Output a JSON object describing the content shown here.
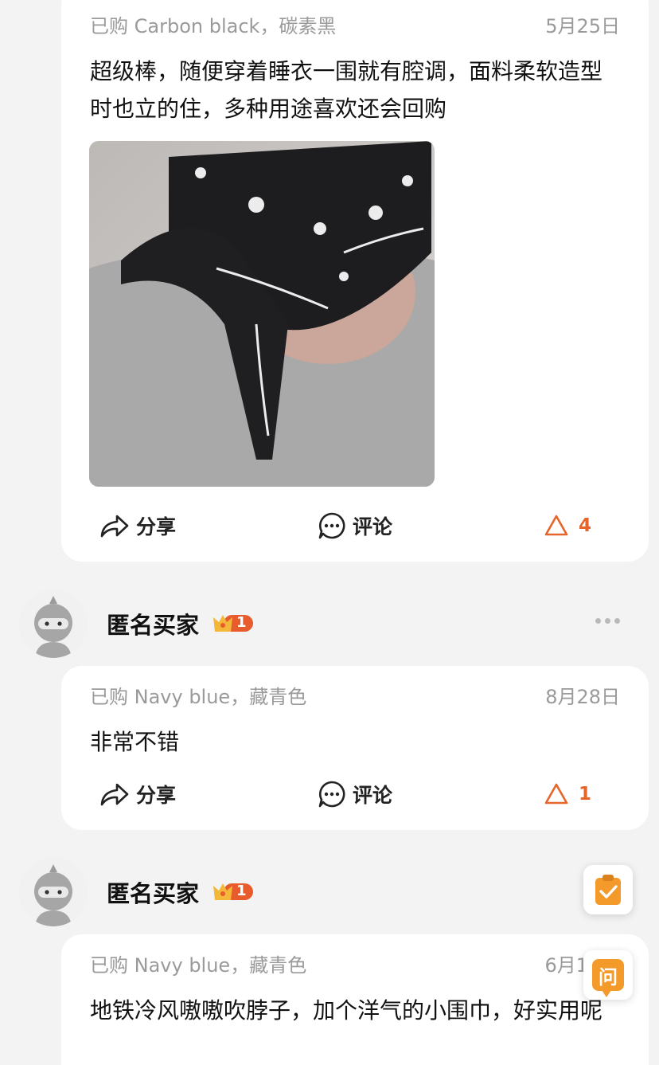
{
  "reviews": [
    {
      "purchased_variant": "已购 Carbon black，碳素黑",
      "date": "5月25日",
      "text": "超级棒，随便穿着睡衣一围就有腔调，面料柔软造型时也立的住，多种用途喜欢还会回购",
      "share_label": "分享",
      "comment_label": "评论",
      "like_count": "4"
    },
    {
      "user_name": "匿名买家",
      "level": "1",
      "purchased_variant": "已购 Navy blue，藏青色",
      "date": "8月28日",
      "text": "非常不错",
      "share_label": "分享",
      "comment_label": "评论",
      "like_count": "1"
    },
    {
      "user_name": "匿名买家",
      "level": "1",
      "purchased_variant": "已购 Navy blue，藏青色",
      "date": "6月1",
      "text": "地铁冷风嗷嗷吹脖子，加个洋气的小围巾，好实用呢"
    }
  ],
  "floating": {
    "ask_label": "问"
  },
  "colors": {
    "accent": "#e5652a",
    "muted_text": "#9a9a9a",
    "badge_orange": "#f39a2a"
  }
}
